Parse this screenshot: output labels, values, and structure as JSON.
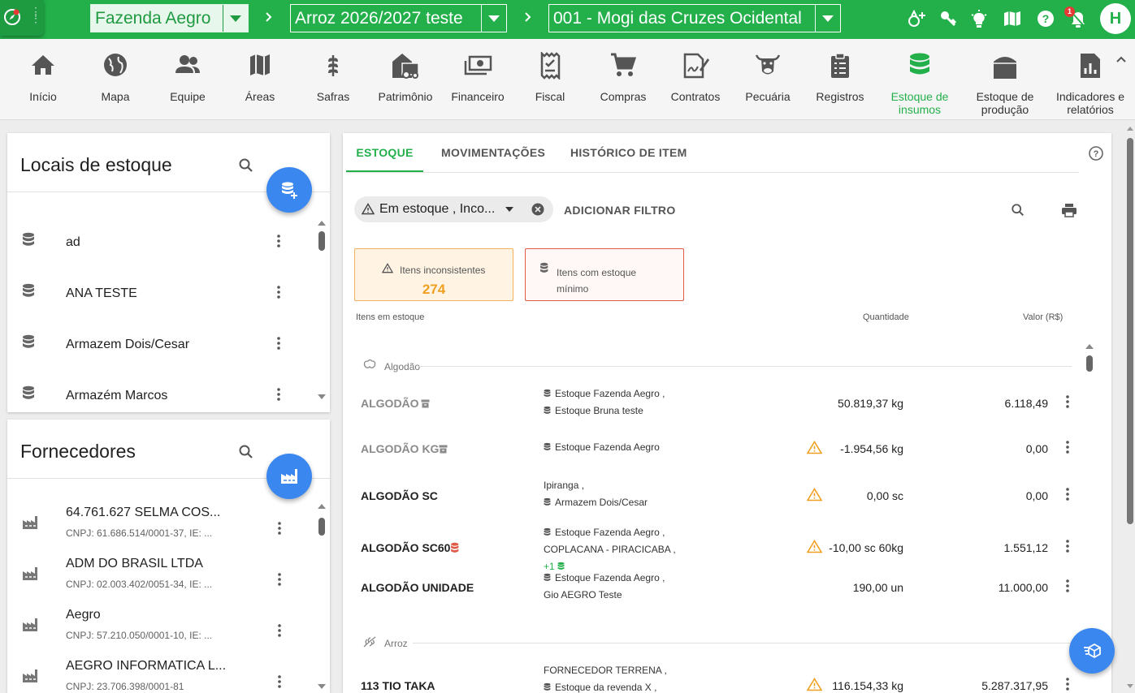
{
  "topbar": {
    "farm": "Fazenda Aegro",
    "season": "Arroz 2026/2027 teste",
    "plot": "001 - Mogi das Cruzes Ocidental",
    "notifications_count": "1",
    "avatar_initial": "H",
    "colors": {
      "brand": "#23b04b",
      "accent_blue": "#3b87f0",
      "warning": "#f0a020",
      "danger": "#e05a48"
    }
  },
  "modules": [
    {
      "label": "Início",
      "icon": "home-icon"
    },
    {
      "label": "Mapa",
      "icon": "globe-icon"
    },
    {
      "label": "Equipe",
      "icon": "team-icon"
    },
    {
      "label": "Áreas",
      "icon": "map-icon"
    },
    {
      "label": "Safras",
      "icon": "wheat-icon"
    },
    {
      "label": "Patrimônio",
      "icon": "barn-tractor-icon"
    },
    {
      "label": "Financeiro",
      "icon": "money-icon"
    },
    {
      "label": "Fiscal",
      "icon": "receipt-icon"
    },
    {
      "label": "Compras",
      "icon": "cart-icon"
    },
    {
      "label": "Contratos",
      "icon": "contract-icon"
    },
    {
      "label": "Pecuária",
      "icon": "cow-icon"
    },
    {
      "label": "Registros",
      "icon": "clipboard-icon"
    },
    {
      "label": "Estoque de insumos",
      "icon": "database-icon"
    },
    {
      "label": "Estoque de produção",
      "icon": "silo-icon"
    },
    {
      "label": "Indicadores e relatórios",
      "icon": "report-icon"
    }
  ],
  "locais": {
    "title": "Locais de estoque",
    "items": [
      "ad",
      "ANA TESTE",
      "Armazem Dois/Cesar",
      "Armazém Marcos"
    ]
  },
  "fornecedores": {
    "title": "Fornecedores",
    "items": [
      {
        "name": "64.761.627 SELMA COS...",
        "sub": "CNPJ: 61.686.514/0001-37, IE: ..."
      },
      {
        "name": "ADM DO BRASIL LTDA",
        "sub": "CNPJ: 02.003.402/0051-34, IE: ..."
      },
      {
        "name": "Aegro",
        "sub": "CNPJ: 57.210.050/0001-10, IE: ..."
      },
      {
        "name": "AEGRO INFORMATICA L...",
        "sub": "CNPJ: 23.706.398/0001-81"
      }
    ]
  },
  "stock": {
    "tabs": [
      "ESTOQUE",
      "MOVIMENTAÇÕES",
      "HISTÓRICO DE ITEM"
    ],
    "filter_chip": "Em estoque , Inco...",
    "add_filter": "ADICIONAR FILTRO",
    "summary": {
      "inconsistent_label": "Itens inconsistentes",
      "inconsistent_count": "274",
      "minimum_label": "Itens com estoque mínimo"
    },
    "columns": {
      "item": "Itens em estoque",
      "qty": "Quantidade",
      "value": "Valor (R$)"
    },
    "groups": [
      {
        "name": "Algodão",
        "items": [
          {
            "name": "ALGODÃO",
            "muted": true,
            "archived": true,
            "locs": [
              "Estoque Fazenda Aegro ,",
              "Estoque Bruna teste"
            ],
            "loc_db": [
              true,
              true
            ],
            "warning": false,
            "qty": "50.819,37 kg",
            "value": "6.118,49"
          },
          {
            "name": "ALGODÃO KG",
            "muted": true,
            "archived": true,
            "locs": [
              "Estoque Fazenda Aegro"
            ],
            "loc_db": [
              true
            ],
            "warning": true,
            "qty": "-1.954,56 kg",
            "value": "0,00"
          },
          {
            "name": "ALGODÃO SC",
            "muted": false,
            "locs": [
              "Ipiranga ,",
              "Armazem Dois/Cesar"
            ],
            "loc_db": [
              false,
              true
            ],
            "warning": true,
            "qty": "0,00 sc",
            "value": "0,00"
          },
          {
            "name": "ALGODÃO SC60",
            "muted": false,
            "min_stock": true,
            "locs": [
              "Estoque Fazenda Aegro ,",
              "COPLACANA - PIRACICABA ,"
            ],
            "loc_db": [
              true,
              false
            ],
            "more": "+1",
            "warning": true,
            "qty": "-10,00 sc 60kg",
            "value": "1.551,12"
          },
          {
            "name": "ALGODÃO UNIDADE",
            "muted": false,
            "locs": [
              "Estoque Fazenda Aegro ,",
              "Gio AEGRO Teste"
            ],
            "loc_db": [
              true,
              false
            ],
            "warning": false,
            "qty": "190,00 un",
            "value": "11.000,00"
          }
        ]
      },
      {
        "name": "Arroz",
        "items": [
          {
            "name": "113 TIO TAKA",
            "muted": false,
            "locs": [
              "FORNECEDOR TERRENA ,",
              "Estoque da revenda X ,"
            ],
            "loc_db": [
              false,
              true
            ],
            "warning": true,
            "qty": "116.154,33 kg",
            "value": "5.287.317,95"
          }
        ]
      }
    ]
  }
}
